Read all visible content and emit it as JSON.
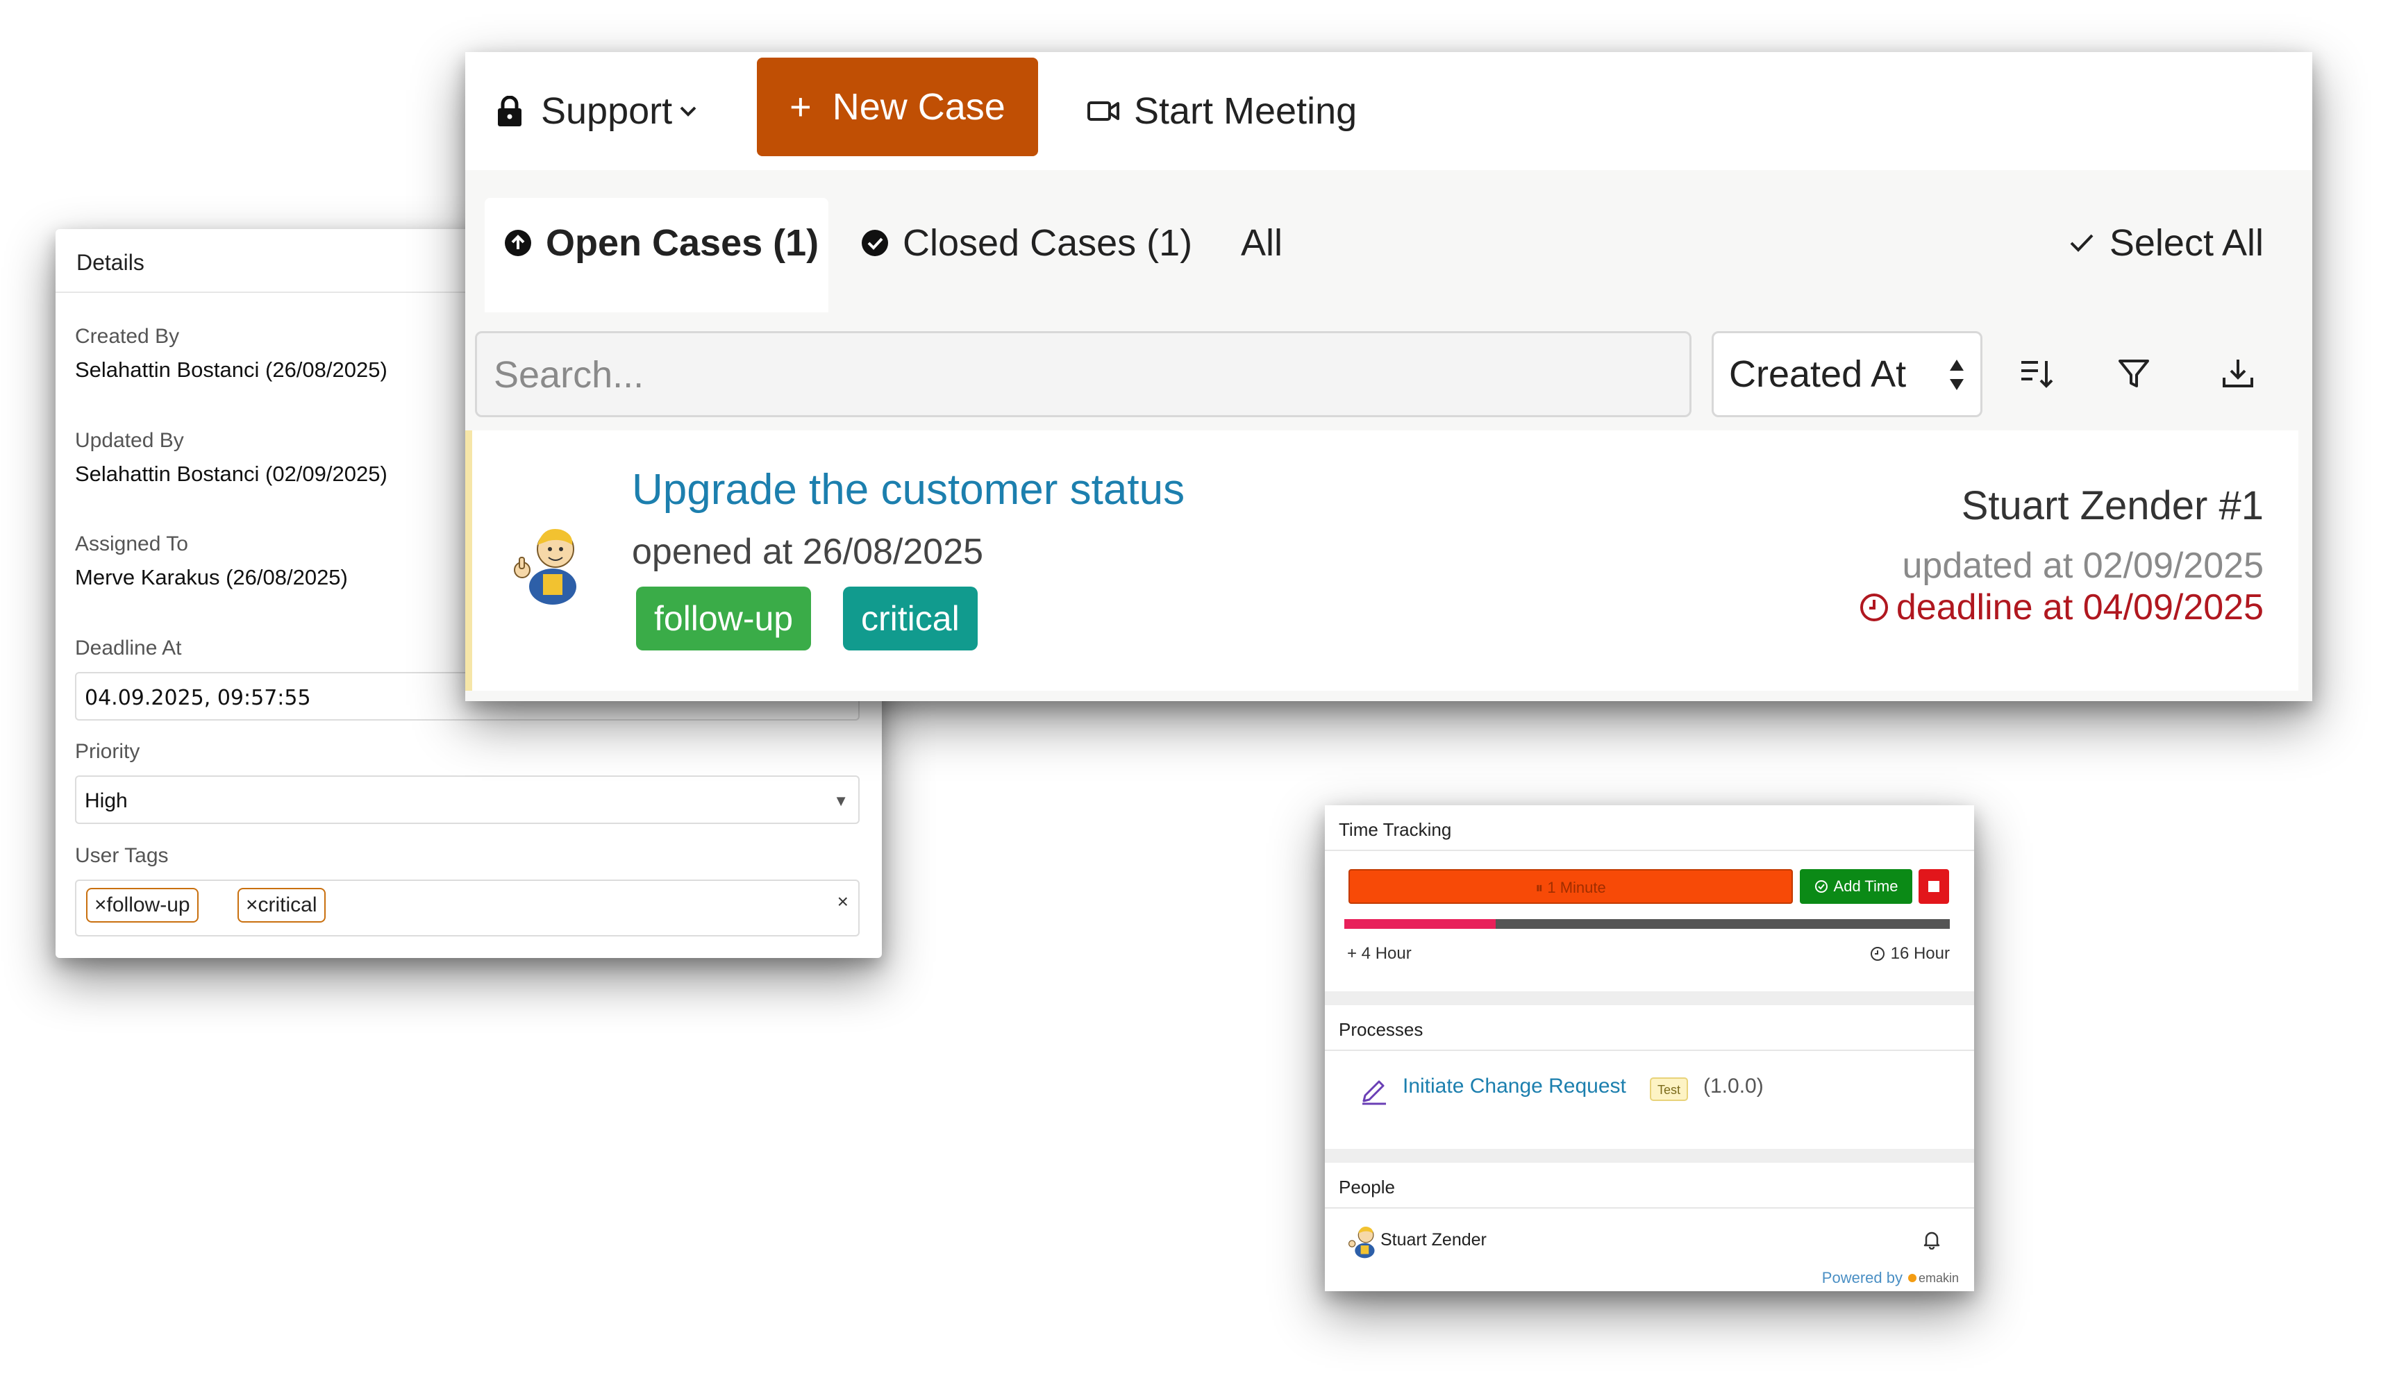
{
  "details": {
    "title": "Details",
    "created_by_label": "Created By",
    "created_by_value": "Selahattin Bostanci (26/08/2025)",
    "updated_by_label": "Updated By",
    "updated_by_value": "Selahattin Bostanci (02/09/2025)",
    "assigned_to_label": "Assigned To",
    "assigned_to_value": "Merve Karakus (26/08/2025)",
    "deadline_label": "Deadline At",
    "deadline_value": "04.09.2025, 09:57:55",
    "priority_label": "Priority",
    "priority_value": "High",
    "user_tags_label": "User Tags",
    "user_tags": [
      "×follow-up",
      "×critical"
    ],
    "clear_glyph": "×"
  },
  "toolbar": {
    "workspace": "Support",
    "new_case": "New Case",
    "new_case_plus": "+",
    "start_meeting": "Start Meeting",
    "accent_color": "#c04f04"
  },
  "tabs": {
    "open": "Open Cases (1)",
    "closed": "Closed Cases (1)",
    "all": "All",
    "select_all": "Select All"
  },
  "filters": {
    "search_placeholder": "Search...",
    "sort_by": "Created At",
    "icons": [
      "sort-direction-icon",
      "filter-icon",
      "download-icon"
    ]
  },
  "case": {
    "title": "Upgrade the customer status",
    "opened": "opened at 26/08/2025",
    "tags": [
      "follow-up",
      "critical"
    ],
    "tag_colors": [
      "#3aac48",
      "#119b8e"
    ],
    "author": "Stuart Zender #1",
    "updated": "updated at 02/09/2025",
    "deadline": "deadline at 04/09/2025",
    "deadline_color": "#b0171f"
  },
  "time_tracking": {
    "title": "Time Tracking",
    "timer": "⏸ 1 Minute",
    "add_time": "Add Time",
    "progress_fraction": 0.25,
    "spent": "+ 4 Hour",
    "estimate": "16 Hour"
  },
  "processes": {
    "title": "Processes",
    "item": "Initiate Change Request",
    "badge": "Test",
    "version": "(1.0.0)"
  },
  "people": {
    "title": "People",
    "name": "Stuart Zender",
    "powered_by": "Powered by",
    "brand": "emakin"
  }
}
